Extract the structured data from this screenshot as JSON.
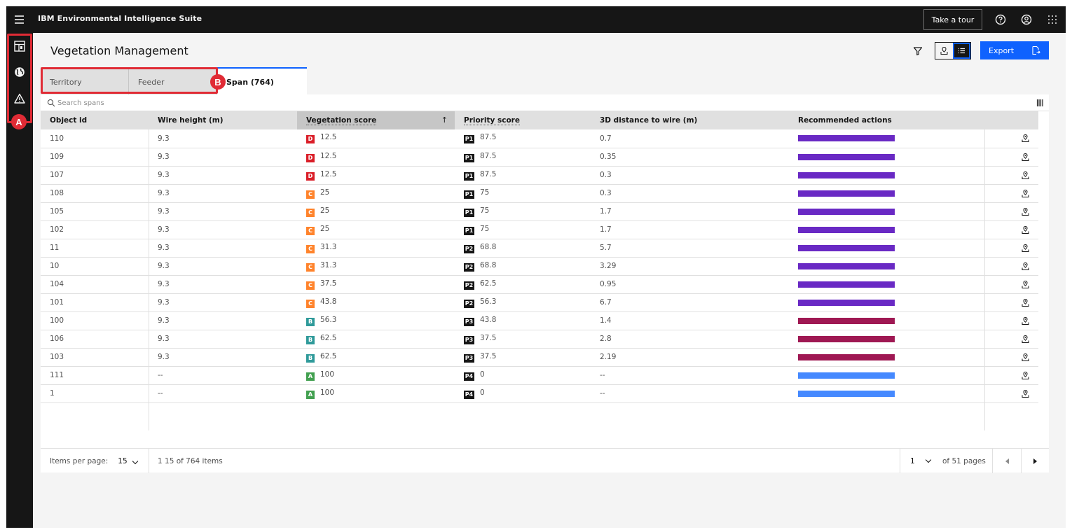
{
  "header": {
    "app_title": "IBM Environmental Intelligence Suite",
    "tour_label": "Take a tour"
  },
  "page": {
    "title": "Vegetation Management",
    "export_label": "Export"
  },
  "annotations": {
    "a": "A",
    "b": "B"
  },
  "tabs": [
    {
      "label": "Territory",
      "active": false
    },
    {
      "label": "Feeder",
      "active": false
    },
    {
      "label": "Span (764)",
      "active": true
    }
  ],
  "search": {
    "placeholder": "Search spans"
  },
  "table": {
    "columns": [
      "Object id",
      "Wire height (m)",
      "Vegetation score",
      "Priority score",
      "3D distance to wire (m)",
      "Recommended actions"
    ],
    "rows": [
      {
        "id": "110",
        "wire": "9.3",
        "grade": "D",
        "veg": "12.5",
        "p": "P1",
        "prio": "87.5",
        "dist": "0.7",
        "action_color": "#6929c4"
      },
      {
        "id": "109",
        "wire": "9.3",
        "grade": "D",
        "veg": "12.5",
        "p": "P1",
        "prio": "87.5",
        "dist": "0.35",
        "action_color": "#6929c4"
      },
      {
        "id": "107",
        "wire": "9.3",
        "grade": "D",
        "veg": "12.5",
        "p": "P1",
        "prio": "87.5",
        "dist": "0.3",
        "action_color": "#6929c4"
      },
      {
        "id": "108",
        "wire": "9.3",
        "grade": "C",
        "veg": "25",
        "p": "P1",
        "prio": "75",
        "dist": "0.3",
        "action_color": "#6929c4"
      },
      {
        "id": "105",
        "wire": "9.3",
        "grade": "C",
        "veg": "25",
        "p": "P1",
        "prio": "75",
        "dist": "1.7",
        "action_color": "#6929c4"
      },
      {
        "id": "102",
        "wire": "9.3",
        "grade": "C",
        "veg": "25",
        "p": "P1",
        "prio": "75",
        "dist": "1.7",
        "action_color": "#6929c4"
      },
      {
        "id": "11",
        "wire": "9.3",
        "grade": "C",
        "veg": "31.3",
        "p": "P2",
        "prio": "68.8",
        "dist": "5.7",
        "action_color": "#6929c4"
      },
      {
        "id": "10",
        "wire": "9.3",
        "grade": "C",
        "veg": "31.3",
        "p": "P2",
        "prio": "68.8",
        "dist": "3.29",
        "action_color": "#6929c4"
      },
      {
        "id": "104",
        "wire": "9.3",
        "grade": "C",
        "veg": "37.5",
        "p": "P2",
        "prio": "62.5",
        "dist": "0.95",
        "action_color": "#6929c4"
      },
      {
        "id": "101",
        "wire": "9.3",
        "grade": "C",
        "veg": "43.8",
        "p": "P2",
        "prio": "56.3",
        "dist": "6.7",
        "action_color": "#6929c4"
      },
      {
        "id": "100",
        "wire": "9.3",
        "grade": "B",
        "veg": "56.3",
        "p": "P3",
        "prio": "43.8",
        "dist": "1.4",
        "action_color": "#9f1853"
      },
      {
        "id": "106",
        "wire": "9.3",
        "grade": "B",
        "veg": "62.5",
        "p": "P3",
        "prio": "37.5",
        "dist": "2.8",
        "action_color": "#9f1853"
      },
      {
        "id": "103",
        "wire": "9.3",
        "grade": "B",
        "veg": "62.5",
        "p": "P3",
        "prio": "37.5",
        "dist": "2.19",
        "action_color": "#9f1853"
      },
      {
        "id": "111",
        "wire": "--",
        "grade": "A",
        "veg": "100",
        "p": "P4",
        "prio": "0",
        "dist": "--",
        "action_color": "#4589ff"
      },
      {
        "id": "1",
        "wire": "--",
        "grade": "A",
        "veg": "100",
        "p": "P4",
        "prio": "0",
        "dist": "--",
        "action_color": "#4589ff"
      }
    ]
  },
  "grade_colors": {
    "A": "#42a050",
    "B": "#2f9a9a",
    "C": "#ff832b",
    "D": "#da1e28"
  },
  "pagination": {
    "items_per_page_label": "Items per page:",
    "items_per_page": "15",
    "range_text": "1 15 of 764 items",
    "current_page": "1",
    "pages_text": "of 51 pages"
  }
}
